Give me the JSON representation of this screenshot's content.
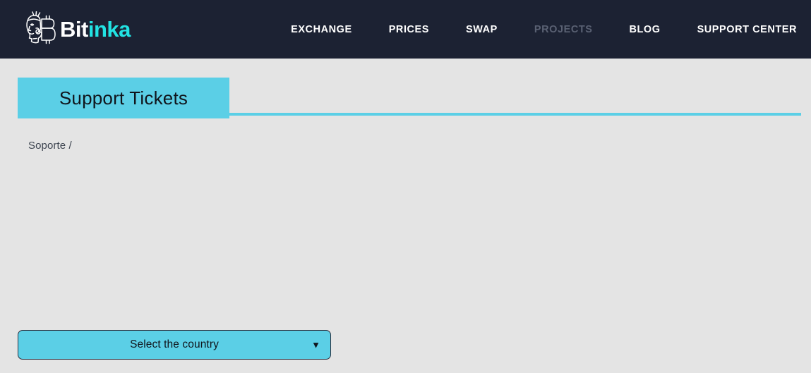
{
  "navbar": {
    "brand": {
      "icon": "inca-bitcoin-logo-icon",
      "text_primary": "Bit",
      "text_accent": "inka"
    },
    "links": [
      {
        "label": "EXCHANGE",
        "muted": false
      },
      {
        "label": "PRICES",
        "muted": false
      },
      {
        "label": "SWAP",
        "muted": false
      },
      {
        "label": "PROJECTS",
        "muted": true
      },
      {
        "label": "BLOG",
        "muted": false
      },
      {
        "label": "SUPPORT CENTER",
        "muted": false
      }
    ],
    "background_color": "#1c2233"
  },
  "page": {
    "background_color": "#e4e4e4",
    "tab": {
      "label": "Support Tickets",
      "accent_color": "#5bcfe6"
    },
    "breadcrumb": {
      "item": "Soporte",
      "separator": "/"
    },
    "country_select": {
      "value": "Select the country",
      "caret_icon": "▼",
      "accent_color": "#5bcfe6",
      "border_color": "#2b3140"
    }
  }
}
